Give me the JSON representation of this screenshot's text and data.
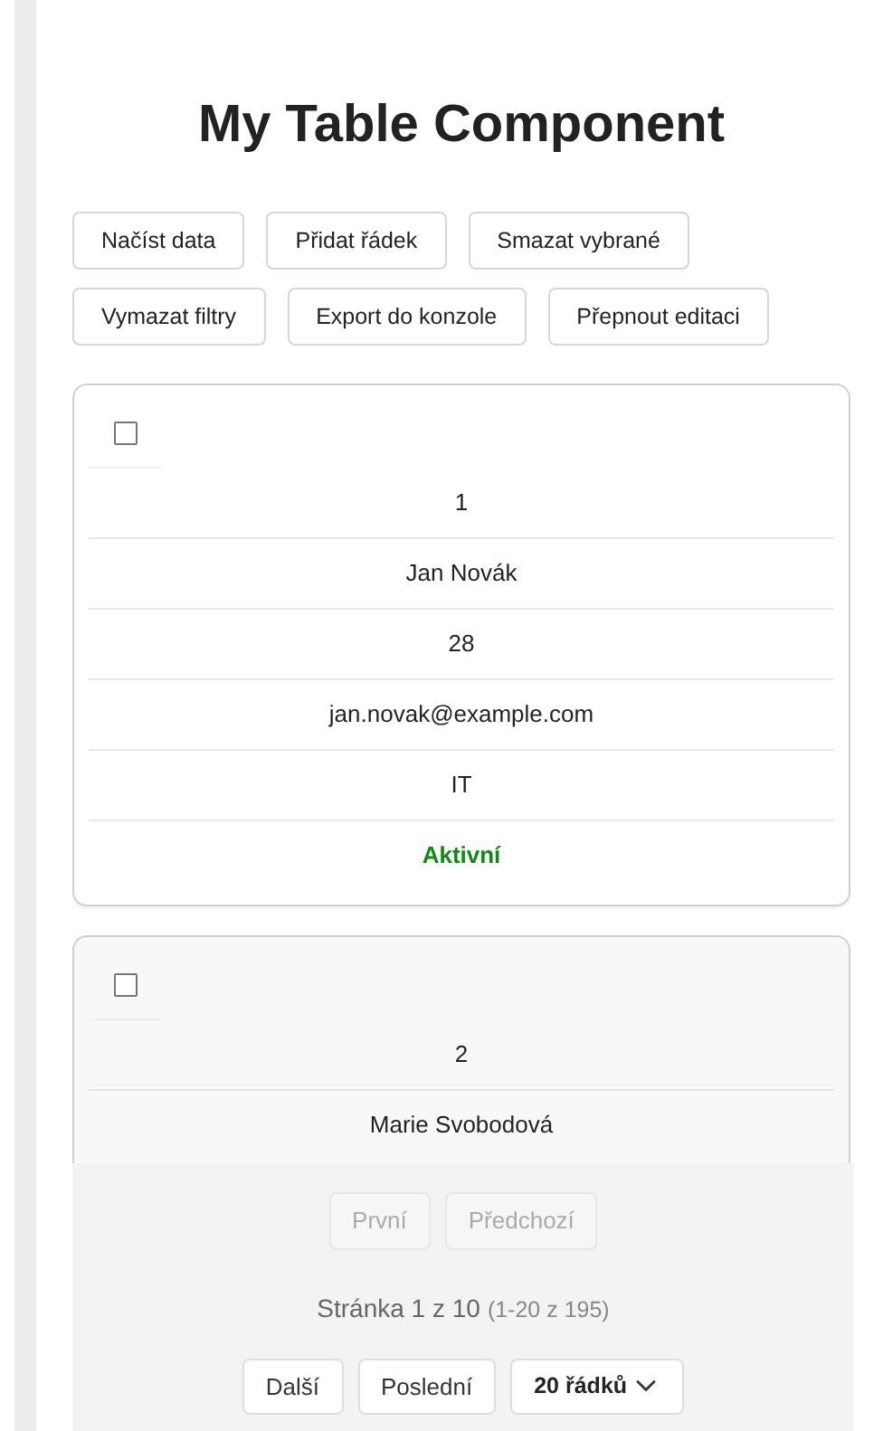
{
  "title": "My Table Component",
  "toolbar": [
    {
      "label": "Načíst data"
    },
    {
      "label": "Přidat řádek"
    },
    {
      "label": "Smazat vybrané"
    },
    {
      "label": "Vymazat filtry"
    },
    {
      "label": "Export do konzole"
    },
    {
      "label": "Přepnout editaci"
    }
  ],
  "rows": [
    {
      "checked": false,
      "cells": [
        {
          "kind": "plain",
          "text": "1"
        },
        {
          "kind": "plain",
          "text": "Jan Novák"
        },
        {
          "kind": "plain",
          "text": "28"
        },
        {
          "kind": "plain",
          "text": "jan.novak@example.com"
        },
        {
          "kind": "plain",
          "text": "IT"
        },
        {
          "kind": "status-active",
          "text": "Aktivní"
        }
      ]
    },
    {
      "checked": false,
      "cells": [
        {
          "kind": "plain",
          "text": "2"
        },
        {
          "kind": "plain",
          "text": "Marie Svobodová"
        }
      ]
    }
  ],
  "pagination": {
    "nav_top": [
      {
        "label": "První",
        "disabled": true
      },
      {
        "label": "Předchozí",
        "disabled": true
      }
    ],
    "page_info": "Stránka 1 z 10",
    "range_info": "(1-20 z 195)",
    "nav_bottom": [
      {
        "label": "Další",
        "disabled": false
      },
      {
        "label": "Poslední",
        "disabled": false
      }
    ],
    "page_size": "20 řádků"
  }
}
